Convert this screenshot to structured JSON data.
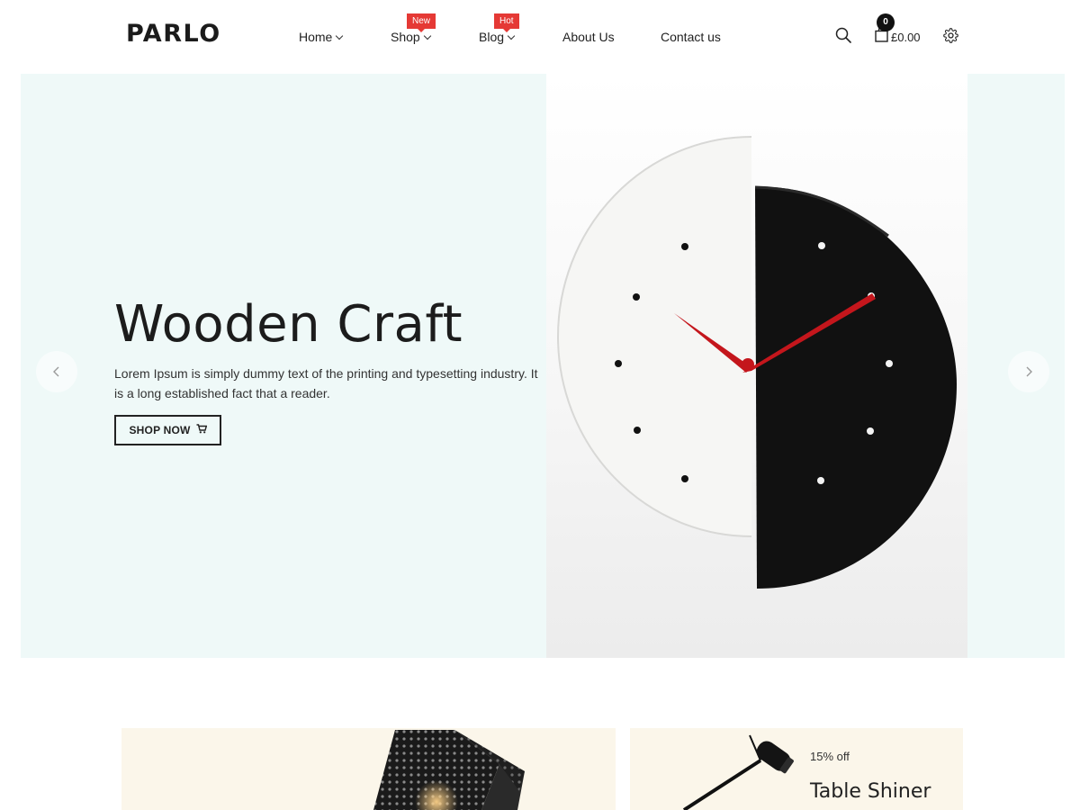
{
  "brand": {
    "logo": "PARLO"
  },
  "nav": {
    "items": [
      {
        "label": "Home",
        "dropdown": true
      },
      {
        "label": "Shop",
        "dropdown": true,
        "badge": "New"
      },
      {
        "label": "Blog",
        "dropdown": true,
        "badge": "Hot"
      },
      {
        "label": "About Us",
        "dropdown": false
      },
      {
        "label": "Contact us",
        "dropdown": false
      }
    ]
  },
  "header_actions": {
    "search_icon": "search-icon",
    "cart_icon": "shopping-bag-icon",
    "cart_count": "0",
    "cart_total": "£0.00",
    "settings_icon": "gear-icon"
  },
  "hero": {
    "title": "Wooden Craft",
    "description": "Lorem Ipsum is simply dummy text of the printing and typesetting industry. It is a long established fact that a reader.",
    "button_label": "SHOP NOW",
    "button_icon": "cart-icon",
    "image": "half-white-half-black-wall-clock",
    "prev_icon": "chevron-left-icon",
    "next_icon": "chevron-right-icon"
  },
  "banners": {
    "left": {
      "image": "perforated-black-lamp"
    },
    "right": {
      "discount": "15% off",
      "title": "Table Shiner",
      "image": "black-desk-lamp"
    }
  },
  "colors": {
    "hero_bg": "#eff9f8",
    "badge": "#e53935",
    "banner_bg": "#fbf6ea",
    "clock_hand": "#c4161c"
  }
}
